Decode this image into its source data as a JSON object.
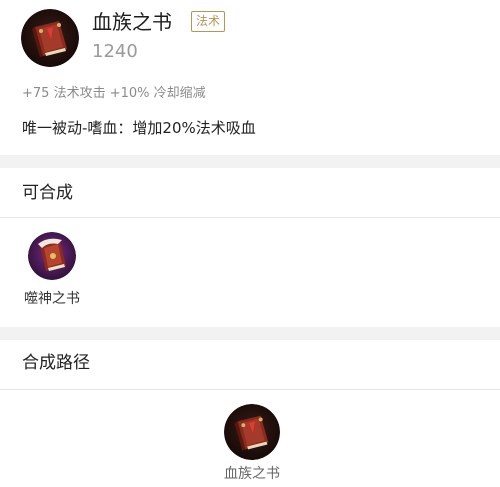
{
  "item": {
    "name": "血族之书",
    "tag": "法术",
    "price": "1240",
    "stats": "+75 法术攻击 +10% 冷却缩减",
    "passive": "唯一被动-嗜血：增加20%法术吸血",
    "icon": "book-of-blood-icon"
  },
  "can_combine": {
    "title": "可合成",
    "items": [
      {
        "label": "噬神之书",
        "icon": "devouring-book-icon"
      }
    ]
  },
  "combine_path": {
    "title": "合成路径",
    "items": [
      {
        "label": "血族之书",
        "icon": "book-of-blood-icon"
      }
    ]
  },
  "colors": {
    "tag_border": "#b8935a",
    "section_gap": "#f2f2f2",
    "book_red": "#8b2a1f"
  }
}
